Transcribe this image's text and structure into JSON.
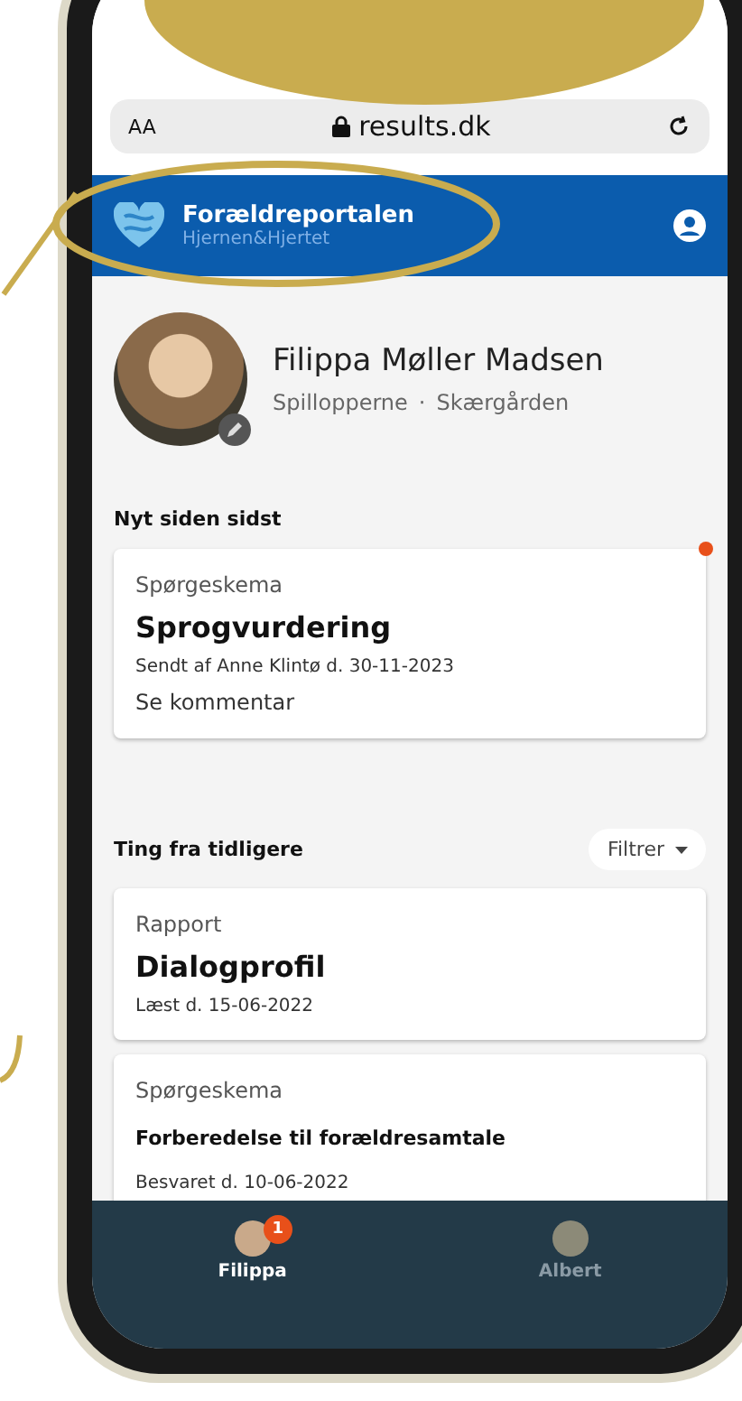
{
  "browser": {
    "text_size": "AA",
    "url": "results.dk"
  },
  "header": {
    "title": "Forældreportalen",
    "subtitle": "Hjernen&Hjertet"
  },
  "profile": {
    "name": "Filippa Møller Madsen",
    "group": "Spillopperne",
    "separator": "·",
    "place": "Skærgården"
  },
  "new_section": {
    "title": "Nyt siden sidst",
    "cards": [
      {
        "type": "Spørgeskema",
        "title": "Sprogvurdering",
        "detail": "Sendt af Anne Klintø d. 30-11-2023",
        "link": "Se kommentar",
        "unread": true,
        "kind": "large"
      }
    ]
  },
  "earlier_section": {
    "title": "Ting fra tidligere",
    "filter": "Filtrer",
    "cards": [
      {
        "type": "Rapport",
        "title": "Dialogprofil",
        "detail": "Læst d. 15-06-2022",
        "unread": false,
        "kind": "large"
      },
      {
        "type": "Spørgeskema",
        "title": "Forberedelse til forældresamtale",
        "detail": "Besvaret d. 10-06-2022",
        "unread": false,
        "kind": "small"
      }
    ]
  },
  "bottom_nav": [
    {
      "label": "Filippa",
      "badge": "1",
      "selected": true
    },
    {
      "label": "Albert",
      "selected": false
    }
  ]
}
